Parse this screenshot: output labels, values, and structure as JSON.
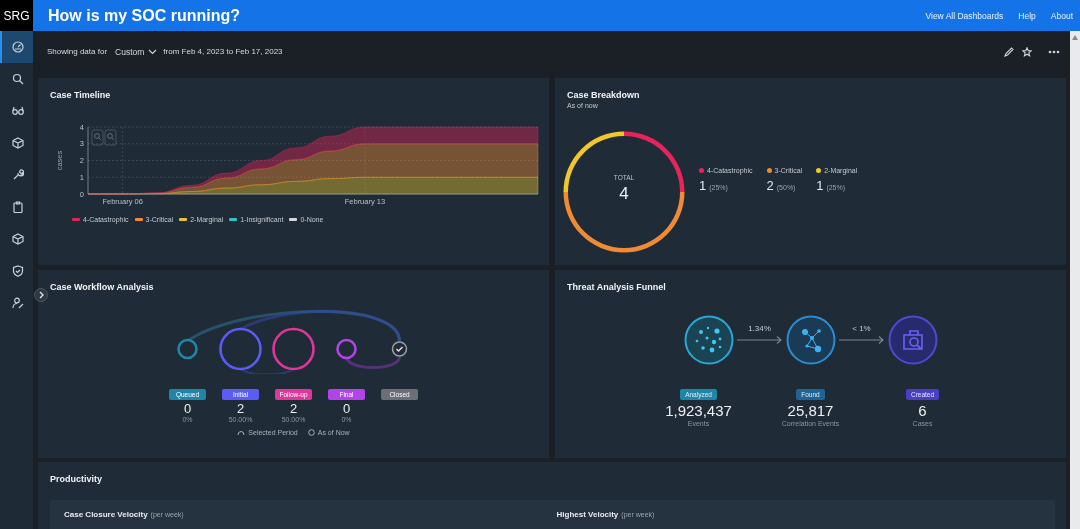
{
  "header": {
    "logo": "SRG",
    "title": "How is my SOC running?",
    "links": [
      "View All Dashboards",
      "Help",
      "About"
    ]
  },
  "sidebar": {
    "items": [
      {
        "selected": true
      },
      {
        "selected": false
      },
      {
        "selected": false
      },
      {
        "selected": false
      },
      {
        "selected": false
      },
      {
        "selected": false
      },
      {
        "selected": false
      },
      {
        "selected": false
      },
      {
        "selected": false
      }
    ]
  },
  "filter": {
    "label": "Showing data for",
    "period": "Custom",
    "range": "from Feb 4, 2023 to Feb 17, 2023"
  },
  "timeline": {
    "title": "Case Timeline",
    "chart_data": {
      "type": "area",
      "stacked": true,
      "ylabel": "cases",
      "categories": [
        null,
        "February 06",
        null,
        null,
        null,
        null,
        null,
        null,
        "February 13",
        null,
        null,
        null,
        null,
        null
      ],
      "ylim": [
        0,
        4
      ],
      "yticks": [
        0,
        1,
        2,
        3,
        4
      ],
      "series": [
        {
          "name": "4-Catastrophic",
          "color": "#e0245a",
          "values": [
            0,
            0,
            0.02,
            0.12,
            0.3,
            0.5,
            0.7,
            0.88,
            1,
            1,
            1,
            1,
            1,
            1
          ]
        },
        {
          "name": "3-Critical",
          "color": "#f08a34",
          "values": [
            0,
            0,
            0.03,
            0.25,
            0.6,
            0.95,
            1.3,
            1.65,
            2,
            2,
            2,
            2,
            2,
            2
          ]
        },
        {
          "name": "2-Marginal",
          "color": "#e6c42c",
          "values": [
            0,
            0,
            0.02,
            0.15,
            0.35,
            0.55,
            0.75,
            0.92,
            1,
            1,
            1,
            1,
            1,
            1
          ]
        },
        {
          "name": "1-Insignificant",
          "color": "#2ec4c0",
          "values": [
            null,
            null,
            null,
            null,
            null,
            null,
            null,
            null,
            null,
            null,
            null,
            null,
            null,
            null
          ]
        },
        {
          "name": "0-None",
          "color": "#d4d8dc",
          "values": [
            null,
            null,
            null,
            null,
            null,
            null,
            null,
            null,
            null,
            null,
            null,
            null,
            null,
            null
          ]
        }
      ],
      "grid": true
    }
  },
  "breakdown": {
    "title": "Case Breakdown",
    "subtitle": "As of now",
    "total_label": "TOTAL",
    "total": "4",
    "chart_data": {
      "type": "donut",
      "categories": [
        "4-Catastrophic",
        "3-Critical",
        "2-Marginal"
      ],
      "values": [
        25,
        50,
        25
      ]
    },
    "legend": [
      {
        "count": "1",
        "percent": "(25%)",
        "color": "#e8245a"
      },
      {
        "count": "2",
        "percent": "(50%)",
        "color": "#f08a34"
      },
      {
        "count": "1",
        "percent": "(25%)",
        "color": "#f0c82c"
      }
    ]
  },
  "workflow": {
    "title": "Case Workflow Analysis",
    "stages": [
      {
        "kind": "state",
        "label": "Queued",
        "count": "0",
        "percent": "0%",
        "color": "#1f86a8"
      },
      {
        "kind": "state",
        "label": "Initial",
        "count": "2",
        "percent": "50.00%",
        "color": "#5b5cf5"
      },
      {
        "kind": "state",
        "label": "Follow-up",
        "count": "2",
        "percent": "50.00%",
        "color": "#e0359a"
      },
      {
        "kind": "state",
        "label": "Final",
        "count": "0",
        "percent": "0%",
        "color": "#b044e8"
      },
      {
        "kind": "end",
        "label": "Closed",
        "color": "#6b7075"
      }
    ],
    "legend": [
      "Selected Period",
      "As of Now"
    ]
  },
  "funnel": {
    "title": "Threat Analysis Funnel",
    "stages": [
      {
        "label": "Analyzed",
        "value": "1,923,437",
        "unit": "Events",
        "color": "#1d87a8"
      },
      {
        "label": "Found",
        "value": "25,817",
        "unit": "Correlation Events",
        "color": "#1f6494"
      },
      {
        "label": "Created",
        "value": "6",
        "unit": "Cases",
        "color": "#4b3dc4"
      }
    ],
    "rates": [
      "1.34%",
      "< 1%"
    ]
  },
  "productivity": {
    "title": "Productivity",
    "cards": [
      {
        "title": "Case Closure Velocity",
        "unit": "(per week)"
      },
      {
        "title": "Highest Velocity",
        "unit": "(per week)"
      }
    ]
  }
}
